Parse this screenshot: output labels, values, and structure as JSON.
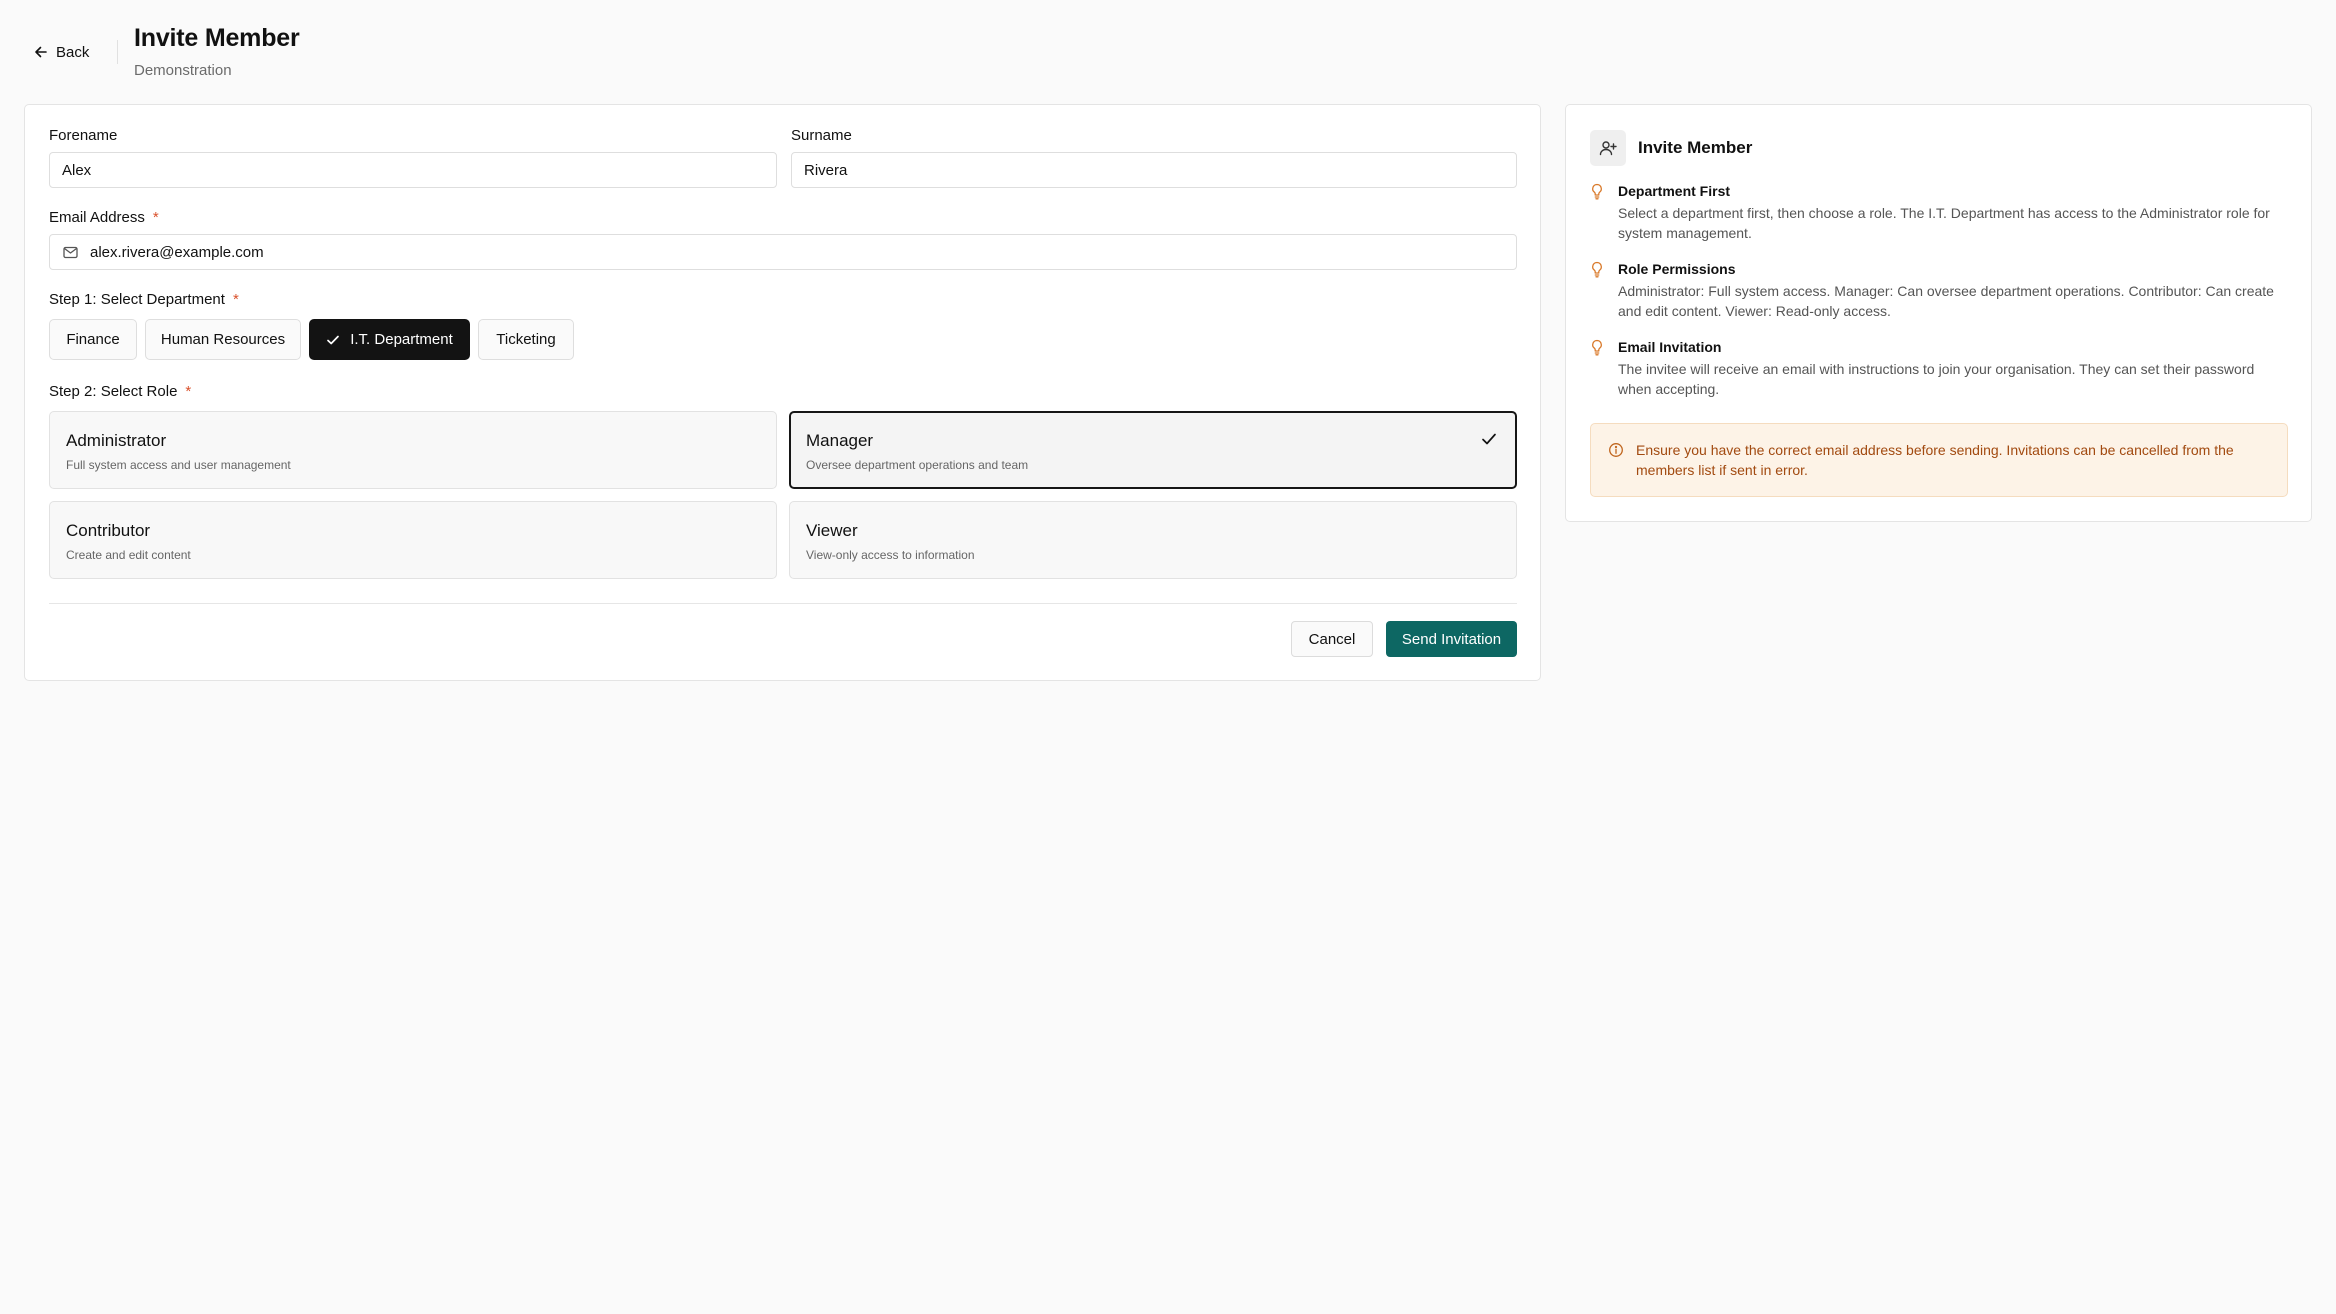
{
  "header": {
    "back_label": "Back",
    "title": "Invite Member",
    "subtitle": "Demonstration"
  },
  "form": {
    "forename": {
      "label": "Forename",
      "value": "Alex"
    },
    "surname": {
      "label": "Surname",
      "value": "Rivera"
    },
    "email": {
      "label": "Email Address",
      "required_mark": "*",
      "value": "alex.rivera@example.com"
    },
    "department": {
      "label": "Step 1: Select Department",
      "required_mark": "*",
      "options": [
        {
          "label": "Finance",
          "selected": false
        },
        {
          "label": "Human Resources",
          "selected": false
        },
        {
          "label": "I.T. Department",
          "selected": true
        },
        {
          "label": "Ticketing",
          "selected": false
        }
      ]
    },
    "role": {
      "label": "Step 2: Select Role",
      "required_mark": "*",
      "options": [
        {
          "title": "Administrator",
          "description": "Full system access and user management",
          "selected": false
        },
        {
          "title": "Manager",
          "description": "Oversee department operations and team",
          "selected": true
        },
        {
          "title": "Contributor",
          "description": "Create and edit content",
          "selected": false
        },
        {
          "title": "Viewer",
          "description": "View-only access to information",
          "selected": false
        }
      ]
    },
    "actions": {
      "cancel_label": "Cancel",
      "submit_label": "Send Invitation"
    }
  },
  "sidebar": {
    "title": "Invite Member",
    "tips": [
      {
        "heading": "Department First",
        "text": "Select a department first, then choose a role. The I.T. Department has access to the Administrator role for system management."
      },
      {
        "heading": "Role Permissions",
        "text": "Administrator: Full system access. Manager: Can oversee department operations. Contributor: Can create and edit content. Viewer: Read-only access."
      },
      {
        "heading": "Email Invitation",
        "text": "The invitee will receive an email with instructions to join your organisation. They can set their password when accepting."
      }
    ],
    "alert": "Ensure you have the correct email address before sending. Invitations can be cancelled from the members list if sent in error."
  },
  "colors": {
    "primary": "#0d6763",
    "selected_dark": "#131313",
    "tip_icon": "#d97a2b",
    "required": "#d9512c",
    "alert_bg": "#fdf3e7",
    "alert_text": "#a24a10"
  },
  "icons": {
    "back": "arrow-left-icon",
    "email": "mail-icon",
    "selected": "check-icon",
    "sidebar": "user-plus-icon",
    "tip": "lightbulb-icon",
    "alert": "info-circle-icon"
  }
}
